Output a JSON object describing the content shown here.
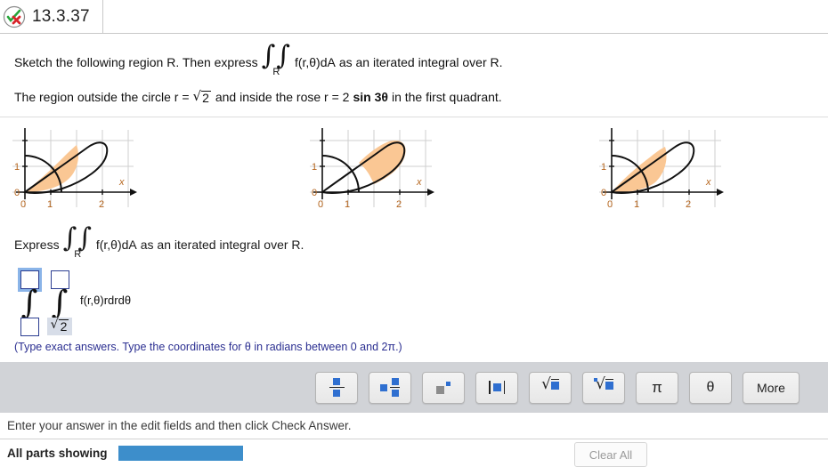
{
  "header": {
    "title": "13.3.37",
    "icon": "check-cross-icon"
  },
  "question": {
    "line1_before": "Sketch the following region R. Then express",
    "integral_sub": "R",
    "integral_integrand": "f(r,θ)dA",
    "line1_after": "as an iterated integral over R.",
    "line2_a": "The region outside the circle r =",
    "line2_radical": "2",
    "line2_b": "and inside the rose r = 2",
    "line2_bold": "sin 3θ",
    "line2_c": "in the first quadrant."
  },
  "graphs": [
    {
      "name": "graph-option-a",
      "xticks": [
        "0",
        "1",
        "2"
      ],
      "yticks": [
        "0",
        "1"
      ],
      "xlabel": "x",
      "shaded_region": "inner-wedge-left"
    },
    {
      "name": "graph-option-b",
      "xticks": [
        "0",
        "1",
        "2"
      ],
      "yticks": [
        "0",
        "1"
      ],
      "xlabel": "x",
      "shaded_region": "outer-petal-tip"
    },
    {
      "name": "graph-option-c",
      "xticks": [
        "0",
        "1",
        "2"
      ],
      "yticks": [
        "0",
        "1"
      ],
      "xlabel": "x",
      "shaded_region": "inside-circle-wedge"
    }
  ],
  "express": {
    "label": "Express",
    "integral_sub": "R",
    "integrand": "f(r,θ)dA",
    "after": "as an iterated integral over R."
  },
  "answer": {
    "outer_upper_value": "",
    "outer_lower_value": "",
    "inner_upper_value": "",
    "inner_lower_value": "2",
    "inner_lower_prefix": "√",
    "integrand": "f(r,θ)rdrdθ",
    "hint": "(Type exact answers. Type the coordinates for θ in radians between 0 and 2π.)"
  },
  "toolbar": {
    "buttons": [
      {
        "name": "fraction-button",
        "glyph": "fraction-icon",
        "label": ""
      },
      {
        "name": "mixed-number-button",
        "glyph": "mixed-fraction-icon",
        "label": ""
      },
      {
        "name": "exponent-button",
        "glyph": "exponent-icon",
        "label": ""
      },
      {
        "name": "absolute-value-button",
        "glyph": "absolute-value-icon",
        "label": ""
      },
      {
        "name": "square-root-button",
        "glyph": "square-root-icon",
        "label": ""
      },
      {
        "name": "nth-root-button",
        "glyph": "nth-root-icon",
        "label": ""
      },
      {
        "name": "pi-button",
        "glyph": "pi-icon",
        "label": "π"
      },
      {
        "name": "theta-button",
        "glyph": "theta-icon",
        "label": "θ"
      },
      {
        "name": "more-button",
        "glyph": "",
        "label": "More"
      }
    ]
  },
  "footer": {
    "enter_message": "Enter your answer in the edit fields and then click Check Answer.",
    "all_parts": "All parts showing",
    "clear_all": "Clear All",
    "progress_color": "#3d8ecb"
  }
}
